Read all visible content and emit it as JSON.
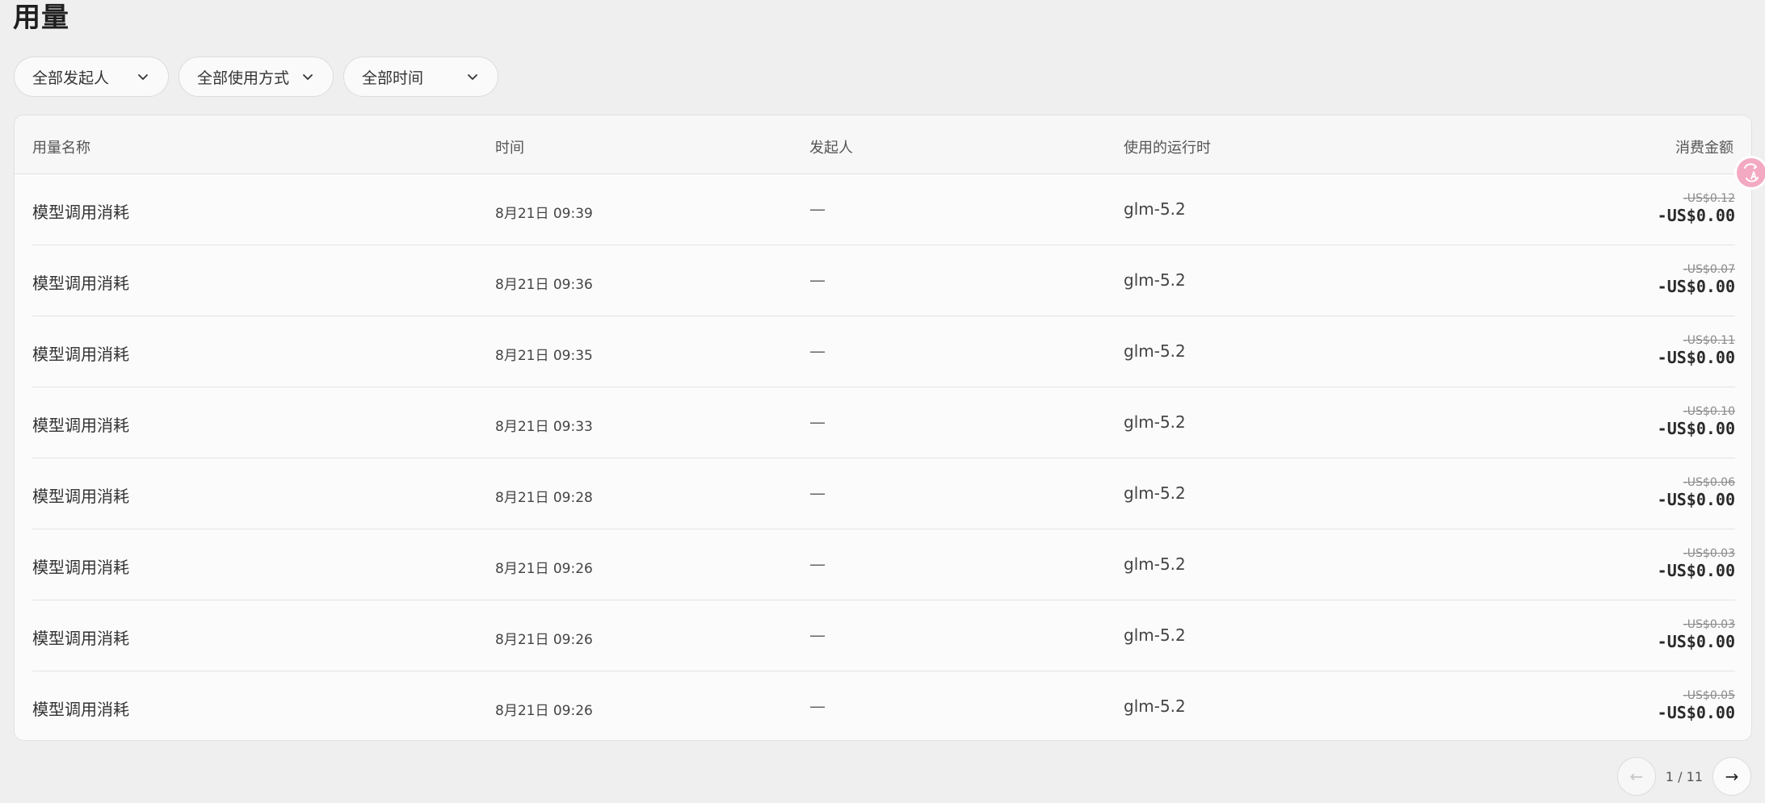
{
  "page": {
    "title": "用量"
  },
  "filters": [
    {
      "label": "全部发起人",
      "icon": "chevron-down-icon"
    },
    {
      "label": "全部使用方式",
      "icon": "chevron-down-icon"
    },
    {
      "label": "全部时间",
      "icon": "chevron-down-icon"
    }
  ],
  "table": {
    "headers": [
      "用量名称",
      "时间",
      "发起人",
      "使用的运行时",
      "消费金额"
    ],
    "rows": [
      {
        "name": "模型调用消耗",
        "time": "8月21日 09:39",
        "initiator": "—",
        "runtime": "glm-5.2",
        "original": "-US$0.12",
        "final": "-US$0.00"
      },
      {
        "name": "模型调用消耗",
        "time": "8月21日 09:36",
        "initiator": "—",
        "runtime": "glm-5.2",
        "original": "-US$0.07",
        "final": "-US$0.00"
      },
      {
        "name": "模型调用消耗",
        "time": "8月21日 09:35",
        "initiator": "—",
        "runtime": "glm-5.2",
        "original": "-US$0.11",
        "final": "-US$0.00"
      },
      {
        "name": "模型调用消耗",
        "time": "8月21日 09:33",
        "initiator": "—",
        "runtime": "glm-5.2",
        "original": "-US$0.10",
        "final": "-US$0.00"
      },
      {
        "name": "模型调用消耗",
        "time": "8月21日 09:28",
        "initiator": "—",
        "runtime": "glm-5.2",
        "original": "-US$0.06",
        "final": "-US$0.00"
      },
      {
        "name": "模型调用消耗",
        "time": "8月21日 09:26",
        "initiator": "—",
        "runtime": "glm-5.2",
        "original": "-US$0.03",
        "final": "-US$0.00"
      },
      {
        "name": "模型调用消耗",
        "time": "8月21日 09:26",
        "initiator": "—",
        "runtime": "glm-5.2",
        "original": "-US$0.03",
        "final": "-US$0.00"
      },
      {
        "name": "模型调用消耗",
        "time": "8月21日 09:26",
        "initiator": "—",
        "runtime": "glm-5.2",
        "original": "-US$0.05",
        "final": "-US$0.00"
      }
    ]
  },
  "pagination": {
    "info": "1 / 11",
    "prev_icon": "arrow-left-icon",
    "next_icon": "arrow-right-icon"
  },
  "translate_badge": {
    "icon": "translate-icon",
    "color": "#f3a9c2"
  }
}
